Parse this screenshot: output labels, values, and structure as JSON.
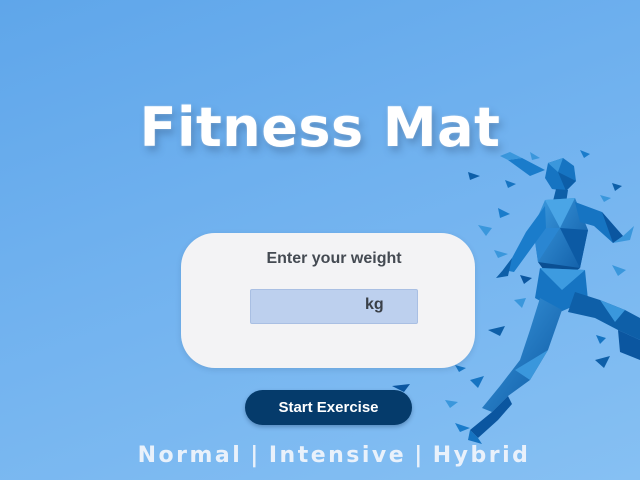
{
  "app": {
    "title": "Fitness Mat"
  },
  "weight_card": {
    "label": "Enter your weight",
    "input_value": "",
    "unit": "kg"
  },
  "start_button": {
    "label": "Start Exercise"
  },
  "modes": {
    "items": [
      "Normal",
      "Intensive",
      "Hybrid"
    ],
    "separator": "|"
  },
  "icons": {
    "runner": "low-poly-runner-illustration"
  },
  "colors": {
    "background_start": "#5fa6ea",
    "background_end": "#86c0f3",
    "button": "#053b6b",
    "card": "#f3f3f5",
    "input": "#bdd0ee",
    "runner_dark": "#0e5fa8",
    "runner_light": "#3d9be0"
  }
}
